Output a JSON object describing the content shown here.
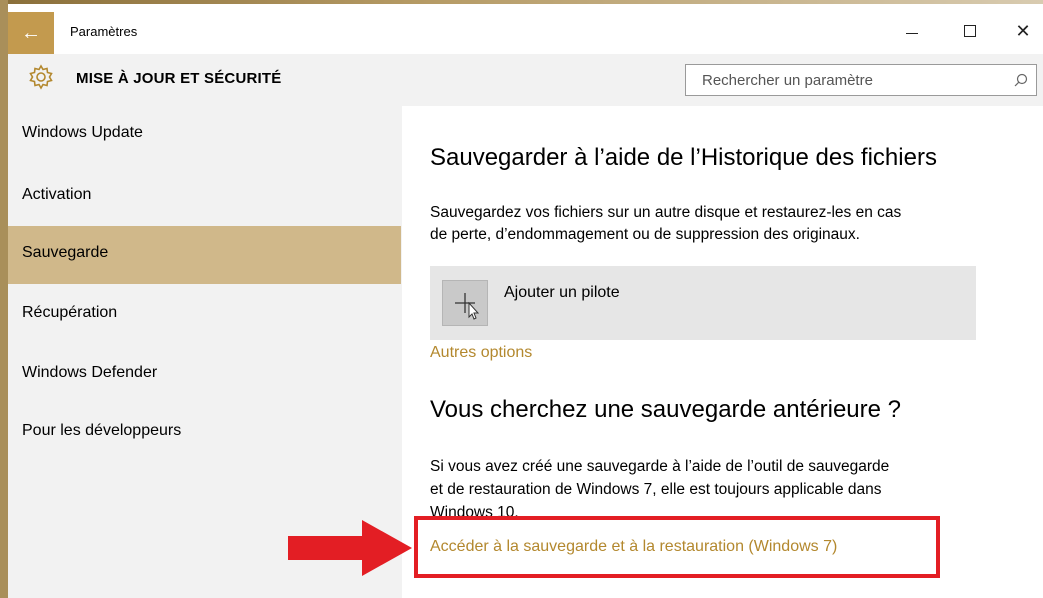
{
  "window": {
    "title": "Paramètres",
    "back_icon": "arrow-left-icon",
    "accent_color": "#c39a4e",
    "selected_color": "#d0b88a",
    "link_color": "#b3882e"
  },
  "header": {
    "title": "MISE À JOUR ET SÉCURITÉ",
    "icon": "gear-icon"
  },
  "search": {
    "placeholder": "Rechercher un paramètre",
    "icon": "search-icon"
  },
  "sidebar": {
    "items": [
      {
        "label": "Windows Update",
        "selected": false
      },
      {
        "label": "Activation",
        "selected": false
      },
      {
        "label": "Sauvegarde",
        "selected": true
      },
      {
        "label": "Récupération",
        "selected": false
      },
      {
        "label": "Windows Defender",
        "selected": false
      },
      {
        "label": "Pour les développeurs",
        "selected": false
      }
    ]
  },
  "main": {
    "section1_title": "Sauvegarder à l’aide de l’Historique des fichiers",
    "section1_desc_line1": "Sauvegardez vos fichiers sur un autre disque et restaurez-les en cas",
    "section1_desc_line2": "de perte, d’endommagement ou de suppression des originaux.",
    "add_drive_label": "Ajouter un pilote",
    "more_options_link": "Autres options",
    "section2_title": "Vous cherchez une sauvegarde antérieure ?",
    "section2_desc_line1": "Si vous avez créé une sauvegarde à l’aide de l’outil de sauvegarde",
    "section2_desc_line2": "et de restauration de Windows 7, elle est toujours applicable dans",
    "section2_desc_line3": "Windows 10.",
    "restore_link": "Accéder à la sauvegarde et à la restauration (Windows 7)"
  },
  "annotation": {
    "highlight_color": "#e31e24"
  }
}
